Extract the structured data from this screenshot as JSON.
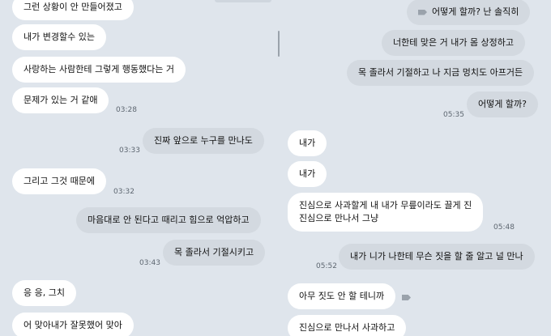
{
  "left": {
    "messages": [
      {
        "text": "그런 상황이 안 만들어졌고"
      },
      {
        "text": "내가 변경할수 있는"
      },
      {
        "text": "사랑하는 사람한테 그렇게 행동했다는 거"
      },
      {
        "text": "문제가 있는 거 같애"
      },
      {
        "text": "진짜 앞으로 누구를 만나도"
      },
      {
        "text": "그리고 그것 때문에"
      },
      {
        "text": "마음대로 안 된다고 때리고 힘으로 억압하고"
      },
      {
        "text": "목 졸라서 기절시키고"
      },
      {
        "text": "응 응, 그치"
      },
      {
        "text": "어 맞아내가 잘못했어 맞아"
      }
    ],
    "times": [
      "03:28",
      "03:33",
      "03:32",
      "03:43"
    ]
  },
  "right": {
    "messages": [
      {
        "text": "어떻게 할까? 난 솔직히"
      },
      {
        "text": "너한테 맞은 거 내가 몸 상정하고"
      },
      {
        "text": "목 졸라서 기절하고 나 지금 멍치도 아프거든"
      },
      {
        "text": "어떻게 할까?"
      },
      {
        "text": "내가"
      },
      {
        "text": "내가"
      },
      {
        "line1": "진심으로 사과할게 내 내가 무릎이라도 끌게 진",
        "line2": "진심으로 만나서 그냥"
      },
      {
        "text": "내가 니가 나한테 무슨 짓을 할 줄 알고 널 만나"
      },
      {
        "text": "아무 짓도 안 할 테니까"
      },
      {
        "text": "진심으로 만나서 사과하고"
      }
    ],
    "times": [
      "05:35",
      "05:48",
      "05:52"
    ]
  }
}
